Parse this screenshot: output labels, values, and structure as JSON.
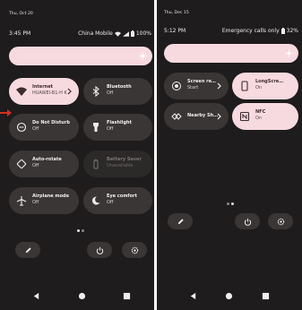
{
  "left_panel": {
    "date": "Thu, Oct 20",
    "time": "3:45 PM",
    "carrier": "China Mobile",
    "battery": "100%",
    "tiles": [
      {
        "label": "Internet",
        "sub": "HUAWEI-B1-H K",
        "state": "on",
        "icon": "wifi-icon",
        "has_chevron": true
      },
      {
        "label": "Bluetooth",
        "sub": "Off",
        "state": "off",
        "icon": "bluetooth-icon",
        "has_chevron": false
      },
      {
        "label": "Do Not Disturb",
        "sub": "Off",
        "state": "off",
        "icon": "do-not-disturb-icon",
        "has_chevron": false
      },
      {
        "label": "Flashlight",
        "sub": "Off",
        "state": "off",
        "icon": "flashlight-icon",
        "has_chevron": false
      },
      {
        "label": "Auto-rotate",
        "sub": "Off",
        "state": "off",
        "icon": "auto-rotate-icon",
        "has_chevron": false
      },
      {
        "label": "Battery Saver",
        "sub": "Unavailable",
        "state": "unavailable",
        "icon": "battery-saver-icon",
        "has_chevron": false
      },
      {
        "label": "Airplane mode",
        "sub": "Off",
        "state": "off",
        "icon": "airplane-icon",
        "has_chevron": false
      },
      {
        "label": "Eye comfort",
        "sub": "Off",
        "state": "off",
        "icon": "eye-comfort-icon",
        "has_chevron": false
      }
    ],
    "page_indicator": {
      "pages": 2,
      "current": 1
    }
  },
  "right_panel": {
    "date": "Thu, Dec 15",
    "time": "5:12 PM",
    "status_text": "Emergency calls only",
    "battery": "32%",
    "tiles": [
      {
        "label": "Screen re…",
        "sub": "Start",
        "state": "off",
        "icon": "screen-record-icon",
        "has_chevron": true
      },
      {
        "label": "LongScre…",
        "sub": "On",
        "state": "on",
        "icon": "long-screenshot-icon",
        "has_chevron": false
      },
      {
        "label": "Nearby Sh…",
        "sub": "",
        "state": "off",
        "icon": "nearby-share-icon",
        "has_chevron": true
      },
      {
        "label": "NFC",
        "sub": "On",
        "state": "on",
        "icon": "nfc-icon",
        "has_chevron": false
      }
    ],
    "page_indicator": {
      "pages": 2,
      "current": 2
    }
  },
  "colors": {
    "panel_bg": "#1e1c1c",
    "tile_off": "#3a3636",
    "tile_on": "#f7d9e0",
    "arrow": "#d0301f"
  }
}
